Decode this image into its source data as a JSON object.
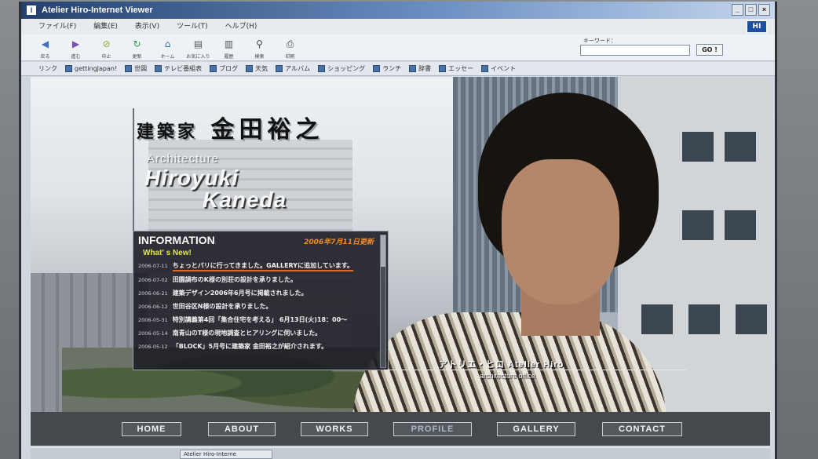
{
  "window": {
    "title": "Atelier Hiro-Internet Viewer",
    "app_icon": "I",
    "controls": [
      "_",
      "□",
      "×"
    ],
    "logo_text": "HI"
  },
  "menu": [
    "ファイル(F)",
    "編集(E)",
    "表示(V)",
    "ツール(T)",
    "ヘルプ(H)"
  ],
  "toolbar": {
    "buttons": [
      {
        "label": "戻る",
        "icon": "back-icon",
        "glyph": "◀",
        "color": "#3a6fc4"
      },
      {
        "label": "進む",
        "icon": "forward-icon",
        "glyph": "▶",
        "color": "#7a4fb0"
      },
      {
        "label": "中止",
        "icon": "stop-icon",
        "glyph": "⊘",
        "color": "#9aa828"
      },
      {
        "label": "更新",
        "icon": "refresh-icon",
        "glyph": "↻",
        "color": "#2f9a4a"
      },
      {
        "label": "ホーム",
        "icon": "home-icon",
        "glyph": "⌂",
        "color": "#2b66b8"
      },
      {
        "label": "お気に入り",
        "icon": "favorites-icon",
        "glyph": "▤",
        "color": "#555555"
      },
      {
        "label": "履歴",
        "icon": "history-icon",
        "glyph": "▥",
        "color": "#555555"
      },
      {
        "label": "検索",
        "icon": "search-icon",
        "glyph": "⚲",
        "color": "#444444"
      },
      {
        "label": "印刷",
        "icon": "print-icon",
        "glyph": "⎙",
        "color": "#444444"
      }
    ],
    "keyword_label": "キーワード：",
    "keyword_value": "",
    "go_label": "GO !"
  },
  "links": {
    "label": "リンク",
    "items": [
      "gettingJapan!",
      "世図",
      "テレビ番組表",
      "ブログ",
      "天気",
      "アルバム",
      "ショッピング",
      "ランチ",
      "辞書",
      "エッセー",
      "イベント"
    ]
  },
  "page": {
    "title_kanji_1": "建築家",
    "title_kanji_2": "金田裕之",
    "arch_label": "Architecture",
    "name_line1": "Hiroyuki",
    "name_line2": "Kaneda",
    "info": {
      "heading": "INFORMATION",
      "updated": "2006年7月11日更新",
      "subheading": "What' s New!",
      "items": [
        {
          "date": "2006-07-11",
          "text": "ちょっとパリに行ってきました。GALLERYに追加しています。"
        },
        {
          "date": "2006-07-02",
          "text": "田園調布のK様の別荘の設計を承りました。"
        },
        {
          "date": "2006-06-21",
          "text": "建築デザイン2006年6月号に掲載されました。"
        },
        {
          "date": "2006-06-12",
          "text": "世田谷区N様の設計を承りました。"
        },
        {
          "date": "2006-05-31",
          "text": "特別講義第4回「集合住宅を考える」 6月13日(火)18：00～"
        },
        {
          "date": "2006-05-14",
          "text": "南青山のT様の現地調査とヒアリングに伺いました。"
        },
        {
          "date": "2006-05-12",
          "text": "「BLOCK」5月号に建築家 金田裕之が紹介されます。"
        }
      ]
    },
    "atelier_name": "アトリエ・ヒロ Atelier Hiro",
    "atelier_sub": "architecture office"
  },
  "nav": [
    "HOME",
    "ABOUT",
    "WORKS",
    "PROFILE",
    "GALLERY",
    "CONTACT"
  ],
  "taskbar": {
    "item": "Atelier Hiro-Interne"
  }
}
